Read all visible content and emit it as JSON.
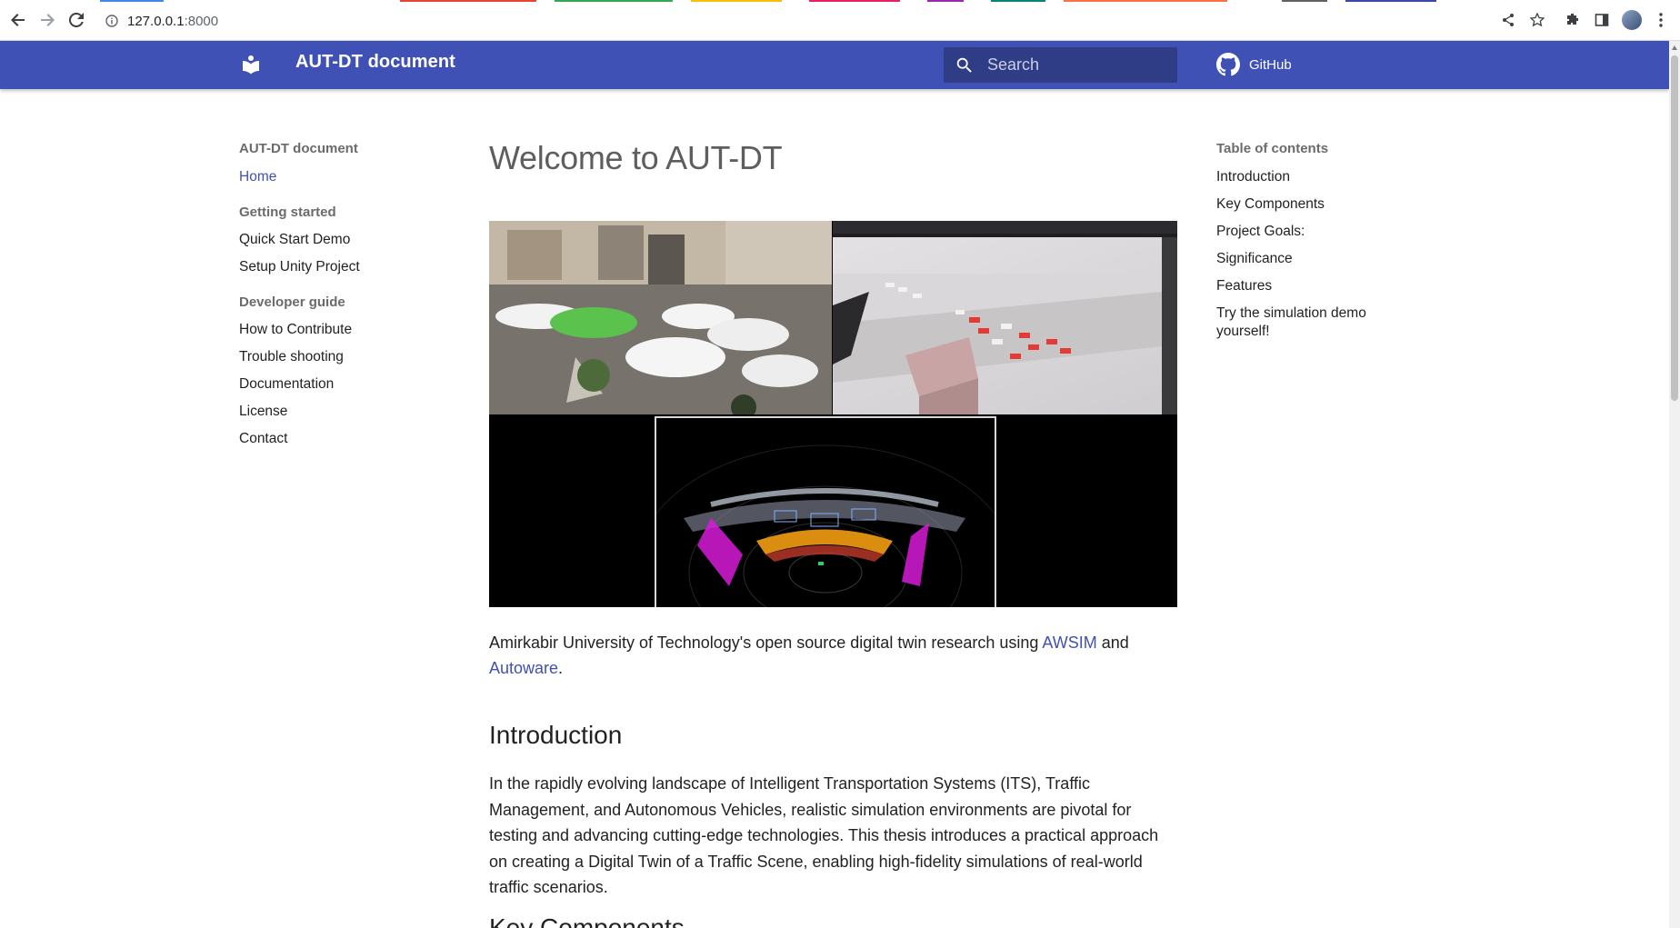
{
  "browser": {
    "url_host": "127.0.0.1",
    "url_port": ":8000",
    "tab_colors": [
      "#4285f4",
      "#ea4335",
      "#34a853",
      "#fbbc05",
      "#9c27b0",
      "#00acc1",
      "#ff7043",
      "#3949ab"
    ]
  },
  "header": {
    "site_title": "AUT-DT document",
    "search_placeholder": "Search",
    "repo_label": "GitHub",
    "bg_color": "#4051b5"
  },
  "nav": {
    "site_title": "AUT-DT document",
    "home": "Home",
    "sections": [
      {
        "title": "Getting started",
        "items": [
          "Quick Start Demo",
          "Setup Unity Project"
        ]
      },
      {
        "title": "Developer guide",
        "items": [
          "How to Contribute",
          "Trouble shooting",
          "Documentation",
          "License",
          "Contact"
        ]
      }
    ]
  },
  "main": {
    "title": "Welcome to AUT-DT",
    "lead": {
      "text_before": "Amirkabir University of Technology's open source digital twin research using ",
      "link1": "AWSIM",
      "text_mid": " and ",
      "link2": "Autoware",
      "text_after": "."
    },
    "intro_heading": "Introduction",
    "intro_text": "In the rapidly evolving landscape of Intelligent Transportation Systems (ITS), Traffic Management, and Autonomous Vehicles, realistic simulation environments are pivotal for testing and advancing cutting-edge technologies. This thesis introduces a practical approach on creating a Digital Twin of a Traffic Scene, enabling high-fidelity simulations of real-world traffic scenarios.",
    "next_heading": "Key Components"
  },
  "toc": {
    "title": "Table of contents",
    "items": [
      "Introduction",
      "Key Components",
      "Project Goals:",
      "Significance",
      "Features",
      "Try the simulation demo yourself!"
    ]
  }
}
